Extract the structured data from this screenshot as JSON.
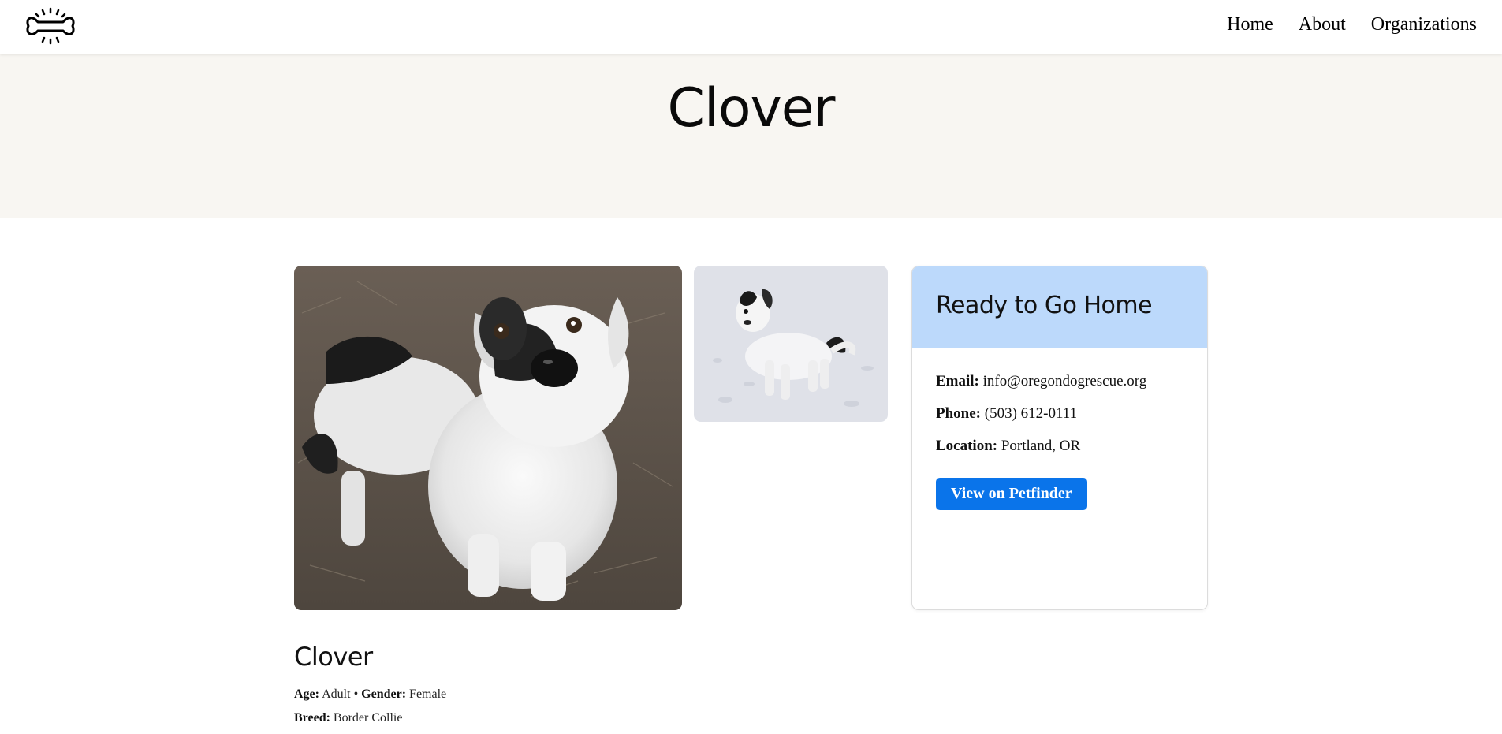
{
  "nav": {
    "logo_icon": "bone-icon",
    "links": [
      "Home",
      "About",
      "Organizations"
    ]
  },
  "hero": {
    "title": "Clover"
  },
  "photos": {
    "main_icon": "dog-photo",
    "thumb_icon": "dog-in-snow-photo"
  },
  "contact_card": {
    "title": "Ready to Go Home",
    "email_label": "Email:",
    "email": "info@oregondogrescue.org",
    "phone_label": "Phone:",
    "phone": "(503) 612-0111",
    "location_label": "Location:",
    "location": "Portland, OR",
    "button_label": "View on Petfinder",
    "header_color": "#bcd9fb",
    "button_color": "#0a74ea"
  },
  "details": {
    "name": "Clover",
    "age_label": "Age:",
    "age": "Adult",
    "separator": "•",
    "gender_label": "Gender:",
    "gender": "Female",
    "breed_label": "Breed:",
    "breed": "Border Collie"
  },
  "colors": {
    "hero_bg": "#f8f6f2",
    "page_bg": "#ffffff"
  }
}
